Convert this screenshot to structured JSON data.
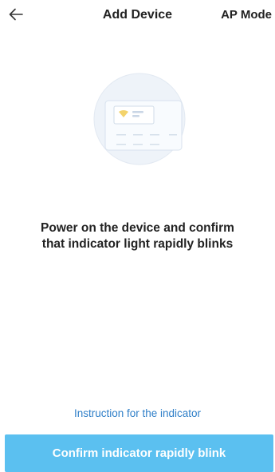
{
  "header": {
    "back_icon": "arrow-left-icon",
    "title": "Add Device",
    "mode_label": "AP Mode"
  },
  "main": {
    "illustration_icon": "device-indicator-illustration",
    "message_line1": "Power on the device and confirm",
    "message_line2": "that indicator light rapidly blinks"
  },
  "footer": {
    "instruction_link": "Instruction for the indicator",
    "confirm_label": "Confirm indicator rapidly blink"
  },
  "colors": {
    "accent": "#5bc0f0",
    "link": "#2f7fc8",
    "text": "#222222",
    "illustration_bg": "#eef3f9"
  }
}
